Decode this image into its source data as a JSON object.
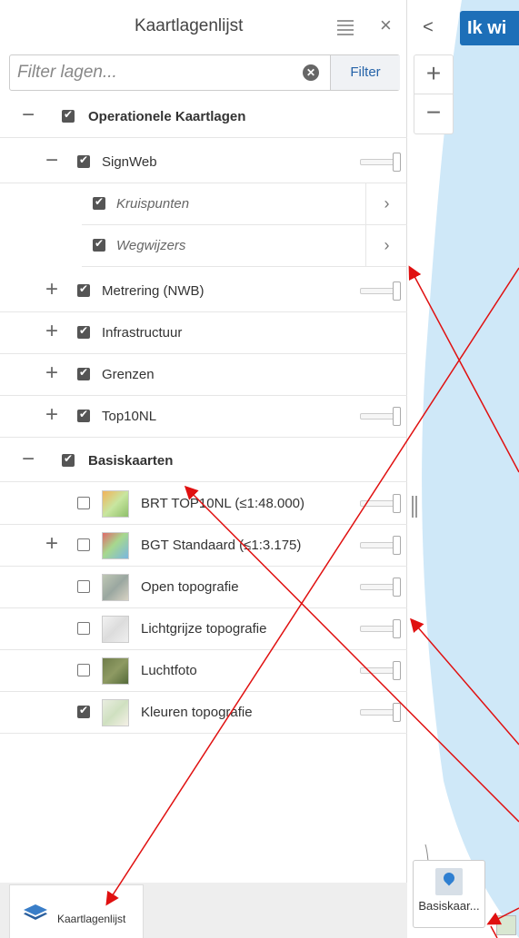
{
  "panel": {
    "title": "Kaartlagenlijst",
    "filter_placeholder": "Filter lagen...",
    "filter_button": "Filter"
  },
  "layers": {
    "operational": "Operationele Kaartlagen",
    "signweb": "SignWeb",
    "kruispunten": "Kruispunten",
    "wegwijzers": "Wegwijzers",
    "metrering": "Metrering (NWB)",
    "infrastructuur": "Infrastructuur",
    "grenzen": "Grenzen",
    "top10nl": "Top10NL",
    "basiskaarten": "Basiskaarten",
    "brt": "BRT TOP10NL (≤1:48.000)",
    "bgt": "BGT Standaard (≤1:3.175)",
    "open": "Open topografie",
    "lichtgrijs": "Lichtgrijze topografie",
    "luchtfoto": "Luchtfoto",
    "kleuren": "Kleuren topografie"
  },
  "footer": {
    "tab_label": "Kaartlagenlijst"
  },
  "map": {
    "banner_text": "Ik wi",
    "basemap_button_label": "Basiskaar..."
  },
  "colors": {
    "accent": "#1d6fb8",
    "annotation_arrow": "#e01010",
    "map_water": "#cfe8f8"
  }
}
